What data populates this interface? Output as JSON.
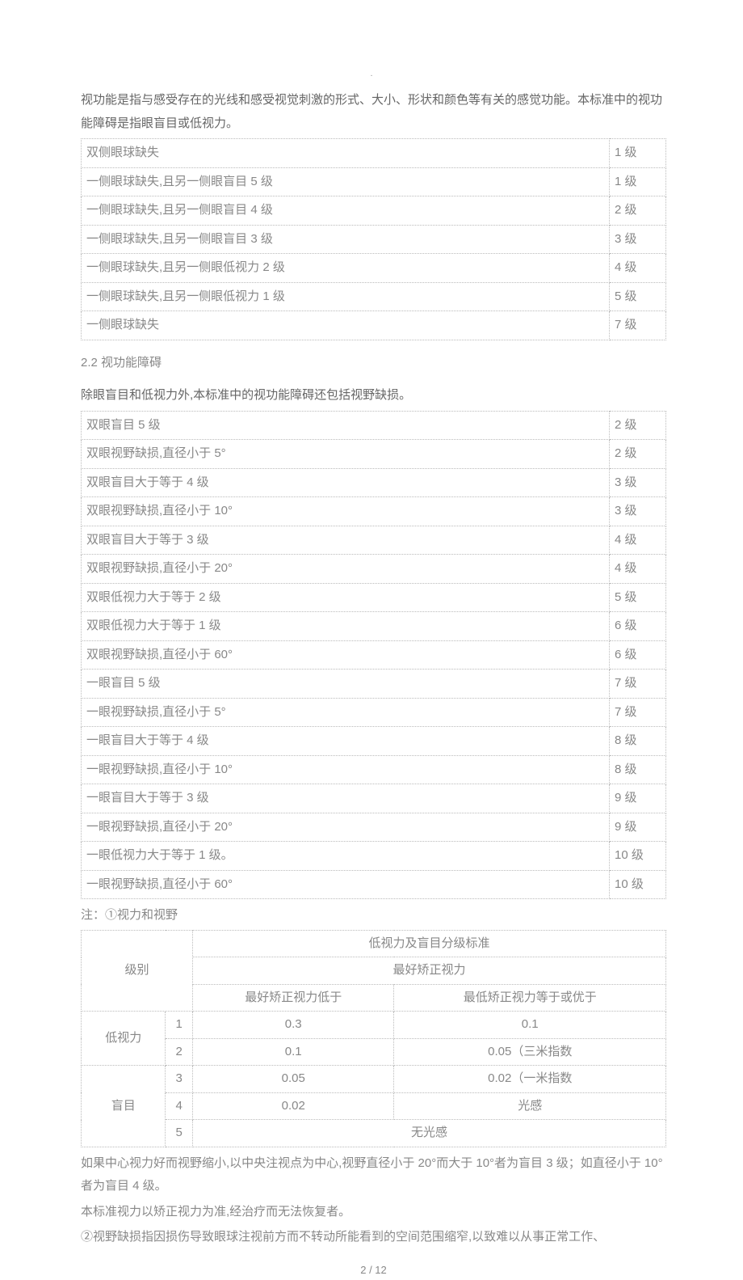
{
  "dot": ".",
  "intro": "视功能是指与感受存在的光线和感受视觉刺激的形式、大小、形状和颜色等有关的感觉功能。本标准中的视功能障碍是指眼盲目或低视力。",
  "table1": [
    {
      "desc": "双侧眼球缺失",
      "grade": "1 级"
    },
    {
      "desc": "一侧眼球缺失,且另一侧眼盲目 5 级",
      "grade": "1 级"
    },
    {
      "desc": "一侧眼球缺失,且另一侧眼盲目 4 级",
      "grade": "2 级"
    },
    {
      "desc": "一侧眼球缺失,且另一侧眼盲目 3 级",
      "grade": "3 级"
    },
    {
      "desc": "一侧眼球缺失,且另一侧眼低视力 2 级",
      "grade": "4 级"
    },
    {
      "desc": "一侧眼球缺失,且另一侧眼低视力 1 级",
      "grade": "5 级"
    },
    {
      "desc": "一侧眼球缺失",
      "grade": "7 级"
    }
  ],
  "sec22_title": "2.2 视功能障碍",
  "sec22_intro": "除眼盲目和低视力外,本标准中的视功能障碍还包括视野缺损。",
  "table2": [
    {
      "desc": "双眼盲目 5 级",
      "grade": "2 级"
    },
    {
      "desc": "双眼视野缺损,直径小于 5°",
      "grade": "2 级"
    },
    {
      "desc": "双眼盲目大于等于 4 级",
      "grade": "3 级"
    },
    {
      "desc": "双眼视野缺损,直径小于 10°",
      "grade": "3 级"
    },
    {
      "desc": "双眼盲目大于等于 3 级",
      "grade": "4 级"
    },
    {
      "desc": "双眼视野缺损,直径小于 20°",
      "grade": "4 级"
    },
    {
      "desc": "双眼低视力大于等于 2 级",
      "grade": "5 级"
    },
    {
      "desc": "双眼低视力大于等于 1 级",
      "grade": "6 级"
    },
    {
      "desc": "双眼视野缺损,直径小于 60°",
      "grade": "6 级"
    },
    {
      "desc": "一眼盲目 5 级",
      "grade": "7 级"
    },
    {
      "desc": "一眼视野缺损,直径小于 5°",
      "grade": "7 级"
    },
    {
      "desc": "一眼盲目大于等于 4 级",
      "grade": "8 级"
    },
    {
      "desc": "一眼视野缺损,直径小于 10°",
      "grade": "8 级"
    },
    {
      "desc": "一眼盲目大于等于 3 级",
      "grade": "9 级"
    },
    {
      "desc": "一眼视野缺损,直径小于 20°",
      "grade": "9 级"
    },
    {
      "desc": "一眼低视力大于等于 1 级。",
      "grade": "10 级"
    },
    {
      "desc": "一眼视野缺损,直径小于 60°",
      "grade": "10 级"
    }
  ],
  "note_header": "注：①视力和视野",
  "table3": {
    "h_level": "级别",
    "h_standard": "低视力及盲目分级标准",
    "h_best": "最好矫正视力",
    "h_below": "最好矫正视力低于",
    "h_above": "最低矫正视力等于或优于",
    "cat_low": "低视力",
    "cat_blind": "盲目",
    "rows": [
      {
        "n": "1",
        "a": "0.3",
        "b": "0.1"
      },
      {
        "n": "2",
        "a": "0.1",
        "b": "0.05（三米指数"
      },
      {
        "n": "3",
        "a": "0.05",
        "b": "0.02（一米指数"
      },
      {
        "n": "4",
        "a": "0.02",
        "b": "光感"
      }
    ],
    "r5n": "5",
    "r5text": "无光感"
  },
  "footnote1": "如果中心视力好而视野缩小,以中央注视点为中心,视野直径小于 20°而大于 10°者为盲目 3 级；如直径小于 10°者为盲目 4 级。",
  "footnote2": "本标准视力以矫正视力为准,经治疗而无法恢复者。",
  "footnote3": "②视野缺损指因损伤导致眼球注视前方而不转动所能看到的空间范围缩窄,以致难以从事正常工作、",
  "page": "2 / 12"
}
